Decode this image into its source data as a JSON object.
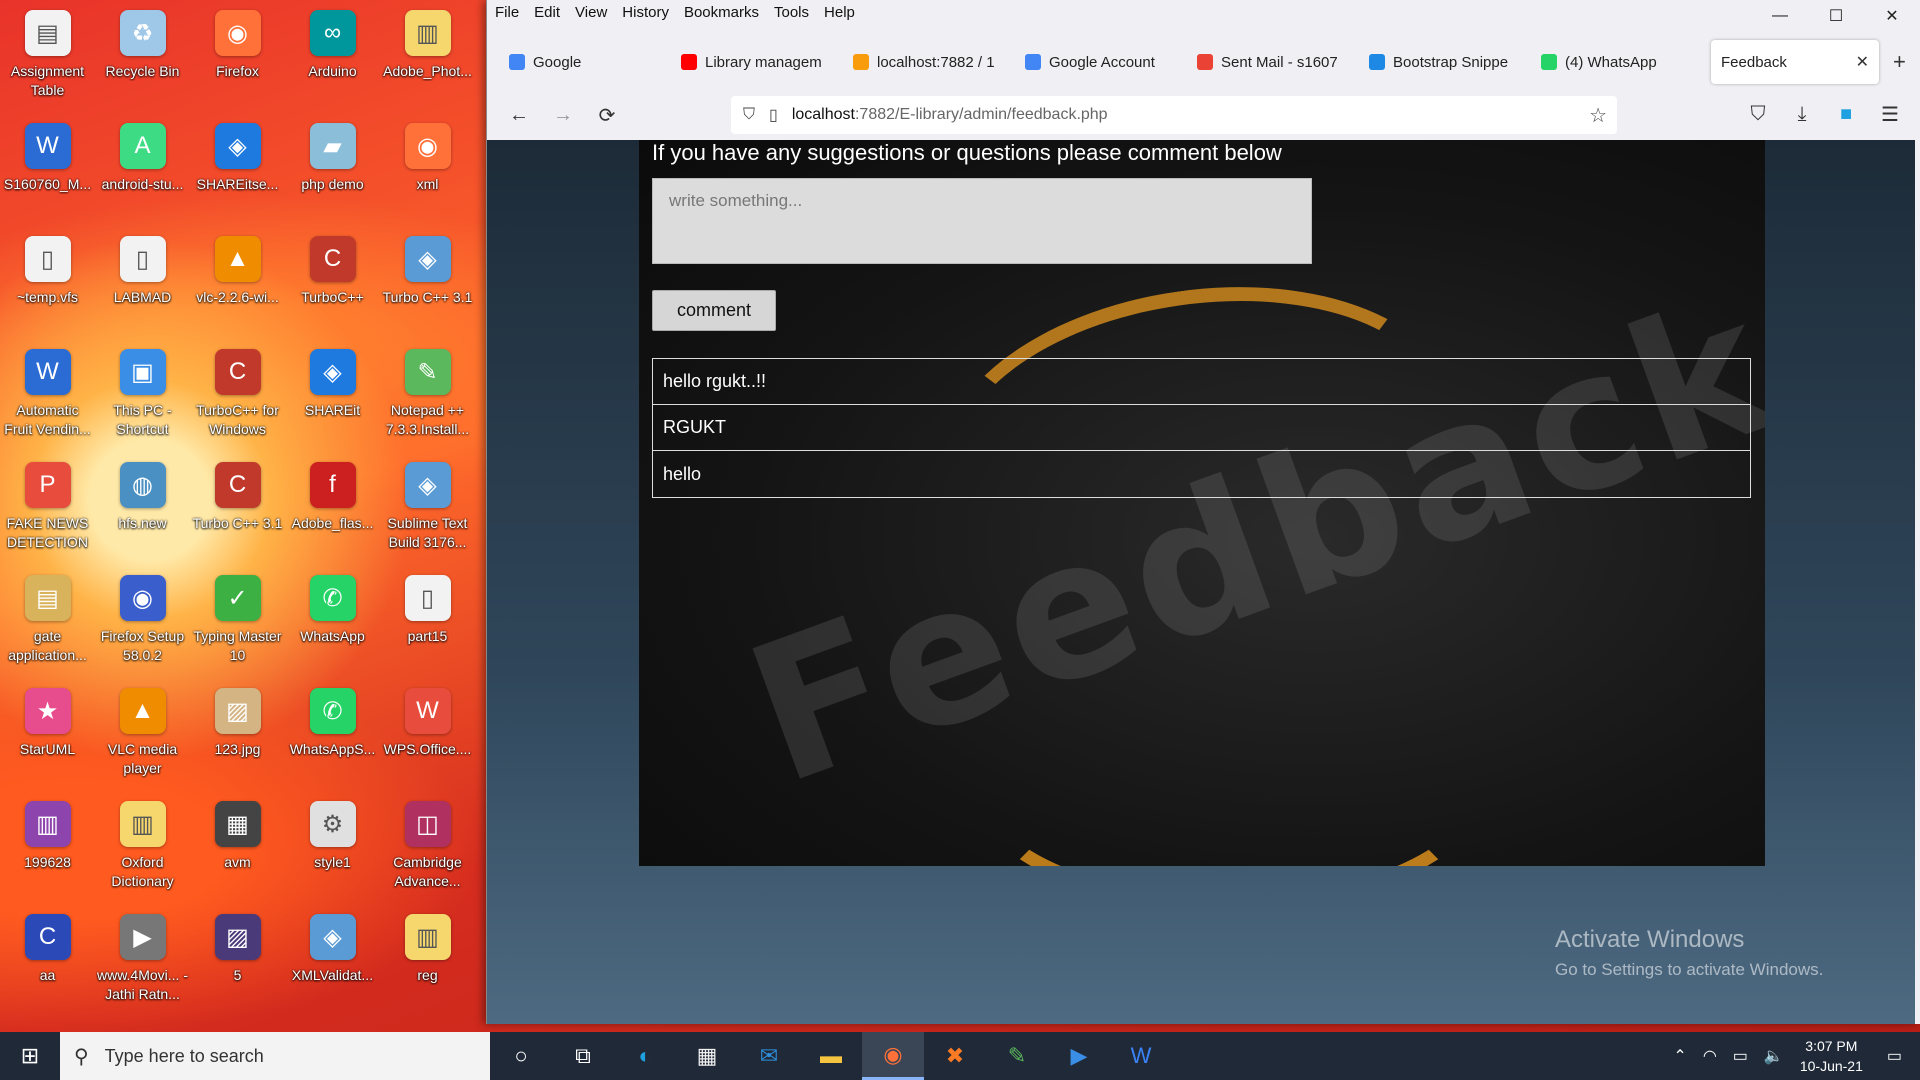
{
  "desktop": {
    "icons": [
      {
        "label": "Assignment Table",
        "icon": "document-icon",
        "color": "#f2f2f2"
      },
      {
        "label": "Recycle Bin",
        "icon": "recycle-bin-icon",
        "color": "#9fc7e8"
      },
      {
        "label": "Firefox",
        "icon": "firefox-icon",
        "color": "#ff7139"
      },
      {
        "label": "Arduino",
        "icon": "arduino-icon",
        "color": "#00979c"
      },
      {
        "label": "Adobe_Phot...",
        "icon": "folder-zip-icon",
        "color": "#f5d76e"
      },
      {
        "label": "S160760_M...",
        "icon": "word-doc-icon",
        "color": "#2b6cd4"
      },
      {
        "label": "android-stu...",
        "icon": "android-studio-icon",
        "color": "#3ddc84"
      },
      {
        "label": "SHAREitse...",
        "icon": "shareit-setup-icon",
        "color": "#1f7ae0"
      },
      {
        "label": "php demo",
        "icon": "php-demo-icon",
        "color": "#8bbfd9"
      },
      {
        "label": "xml",
        "icon": "firefox-file-icon",
        "color": "#ff7139"
      },
      {
        "label": "~temp.vfs",
        "icon": "file-icon",
        "color": "#f2f2f2"
      },
      {
        "label": "LABMAD",
        "icon": "file-icon",
        "color": "#f2f2f2"
      },
      {
        "label": "vlc-2.2.6-wi...",
        "icon": "vlc-installer-icon",
        "color": "#f08c00"
      },
      {
        "label": "TurboC++",
        "icon": "turbo-cpp-icon",
        "color": "#c0392b"
      },
      {
        "label": "Turbo C++ 3.1",
        "icon": "turbo-cpp-setup-icon",
        "color": "#5b9bd5"
      },
      {
        "label": "Automatic Fruit Vendin...",
        "icon": "word-doc-icon",
        "color": "#2b6cd4"
      },
      {
        "label": "This PC - Shortcut",
        "icon": "this-pc-icon",
        "color": "#3a8ee6"
      },
      {
        "label": "TurboC++ for Windows",
        "icon": "turbo-cpp-icon",
        "color": "#c0392b"
      },
      {
        "label": "SHAREit",
        "icon": "shareit-icon",
        "color": "#1f7ae0"
      },
      {
        "label": "Notepad ++ 7.3.3.Install...",
        "icon": "notepad-plus-icon",
        "color": "#5cb85c"
      },
      {
        "label": "FAKE NEWS DETECTION",
        "icon": "pdf-icon",
        "color": "#e74c3c"
      },
      {
        "label": "hfs.new",
        "icon": "hfs-icon",
        "color": "#4a90c2"
      },
      {
        "label": "Turbo C++ 3.1",
        "icon": "turbo-cpp-icon",
        "color": "#c0392b"
      },
      {
        "label": "Adobe_flas...",
        "icon": "adobe-flash-icon",
        "color": "#cc1f1f"
      },
      {
        "label": "Sublime Text Build 3176...",
        "icon": "sublime-setup-icon",
        "color": "#5b9bd5"
      },
      {
        "label": "gate application...",
        "icon": "pdf-doc-icon",
        "color": "#d9b25c"
      },
      {
        "label": "Firefox Setup 58.0.2",
        "icon": "firefox-setup-icon",
        "color": "#3a5fcd"
      },
      {
        "label": "Typing Master 10",
        "icon": "typing-master-icon",
        "color": "#3cb043"
      },
      {
        "label": "WhatsApp",
        "icon": "whatsapp-icon",
        "color": "#25d366"
      },
      {
        "label": "part15",
        "icon": "file-icon",
        "color": "#f2f2f2"
      },
      {
        "label": "StarUML",
        "icon": "staruml-icon",
        "color": "#e74c8c"
      },
      {
        "label": "VLC media player",
        "icon": "vlc-icon",
        "color": "#f08c00"
      },
      {
        "label": "123.jpg",
        "icon": "image-file-icon",
        "color": "#d4b483"
      },
      {
        "label": "WhatsAppS...",
        "icon": "whatsapp-setup-icon",
        "color": "#25d366"
      },
      {
        "label": "WPS.Office....",
        "icon": "wps-office-icon",
        "color": "#e74c3c"
      },
      {
        "label": "199628",
        "icon": "archive-icon",
        "color": "#8e44ad"
      },
      {
        "label": "Oxford Dictionary",
        "icon": "folder-zip-icon",
        "color": "#f5d76e"
      },
      {
        "label": "avm",
        "icon": "folder-icon",
        "color": "#444444"
      },
      {
        "label": "style1",
        "icon": "settings-file-icon",
        "color": "#e0e0e0"
      },
      {
        "label": "Cambridge Advance...",
        "icon": "cambridge-dictionary-icon",
        "color": "#b03060"
      },
      {
        "label": "aa",
        "icon": "c-source-file-icon",
        "color": "#2b4ab8"
      },
      {
        "label": "www.4Movi... - Jathi Ratn...",
        "icon": "video-file-icon",
        "color": "#777777"
      },
      {
        "label": "5",
        "icon": "image-file-icon",
        "color": "#4a3a7a"
      },
      {
        "label": "XMLValidat...",
        "icon": "installer-icon",
        "color": "#5b9bd5"
      },
      {
        "label": "reg",
        "icon": "registry-file-icon",
        "color": "#f5d76e"
      }
    ]
  },
  "browser": {
    "menu": [
      "File",
      "Edit",
      "View",
      "History",
      "Bookmarks",
      "Tools",
      "Help"
    ],
    "window_controls": {
      "minimize": "—",
      "maximize": "☐",
      "close": "✕"
    },
    "tabs": [
      {
        "label": "Google",
        "favicon_color": "#4285f4",
        "favicon": "google-icon"
      },
      {
        "label": "Library managem",
        "favicon_color": "#ff0000",
        "favicon": "youtube-icon"
      },
      {
        "label": "localhost:7882 / 1",
        "favicon_color": "#f89c0e",
        "favicon": "phpmyadmin-icon"
      },
      {
        "label": "Google Account",
        "favicon_color": "#4285f4",
        "favicon": "google-icon"
      },
      {
        "label": "Sent Mail - s1607",
        "favicon_color": "#ea4335",
        "favicon": "gmail-icon"
      },
      {
        "label": "Bootstrap Snippe",
        "favicon_color": "#1e88e5",
        "favicon": "bootstrap-snippet-icon"
      },
      {
        "label": "(4) WhatsApp",
        "favicon_color": "#25d366",
        "favicon": "whatsapp-icon"
      }
    ],
    "active_tab": {
      "label": "Feedback",
      "close": "✕"
    },
    "new_tab": "+",
    "url": {
      "host": "localhost",
      "path": ":7882/E-library/admin/feedback.php"
    }
  },
  "page": {
    "intro": "If you have any suggestions or questions please comment below",
    "comment_placeholder": "write something...",
    "comment_button": "comment",
    "comments": [
      "hello rgukt..!!",
      "RGUKT",
      "hello"
    ],
    "watermark": "Feedback",
    "accent_color": "#e6961e"
  },
  "activation": {
    "title": "Activate Windows",
    "subtitle": "Go to Settings to activate Windows."
  },
  "taskbar": {
    "search_placeholder": "Type here to search",
    "apps": [
      {
        "icon": "cortana-icon",
        "glyph": "○",
        "color": "#ffffff"
      },
      {
        "icon": "task-view-icon",
        "glyph": "⧉",
        "color": "#ffffff"
      },
      {
        "icon": "edge-icon",
        "glyph": "◐",
        "color": "#1fa0e0"
      },
      {
        "icon": "store-icon",
        "glyph": "▦",
        "color": "#f0f0f0"
      },
      {
        "icon": "mail-icon",
        "glyph": "✉",
        "color": "#2f8fdb"
      },
      {
        "icon": "file-explorer-icon",
        "glyph": "▬",
        "color": "#f5c542"
      },
      {
        "icon": "firefox-icon",
        "glyph": "◉",
        "color": "#ff7139"
      },
      {
        "icon": "xampp-icon",
        "glyph": "✖",
        "color": "#fb7a24"
      },
      {
        "icon": "notepad-plus-icon",
        "glyph": "✎",
        "color": "#5cb85c"
      },
      {
        "icon": "media-player-icon",
        "glyph": "▶",
        "color": "#3a8ee6"
      },
      {
        "icon": "wps-writer-icon",
        "glyph": "W",
        "color": "#3b82f6"
      }
    ],
    "time": "3:07 PM",
    "date": "10-Jun-21"
  }
}
